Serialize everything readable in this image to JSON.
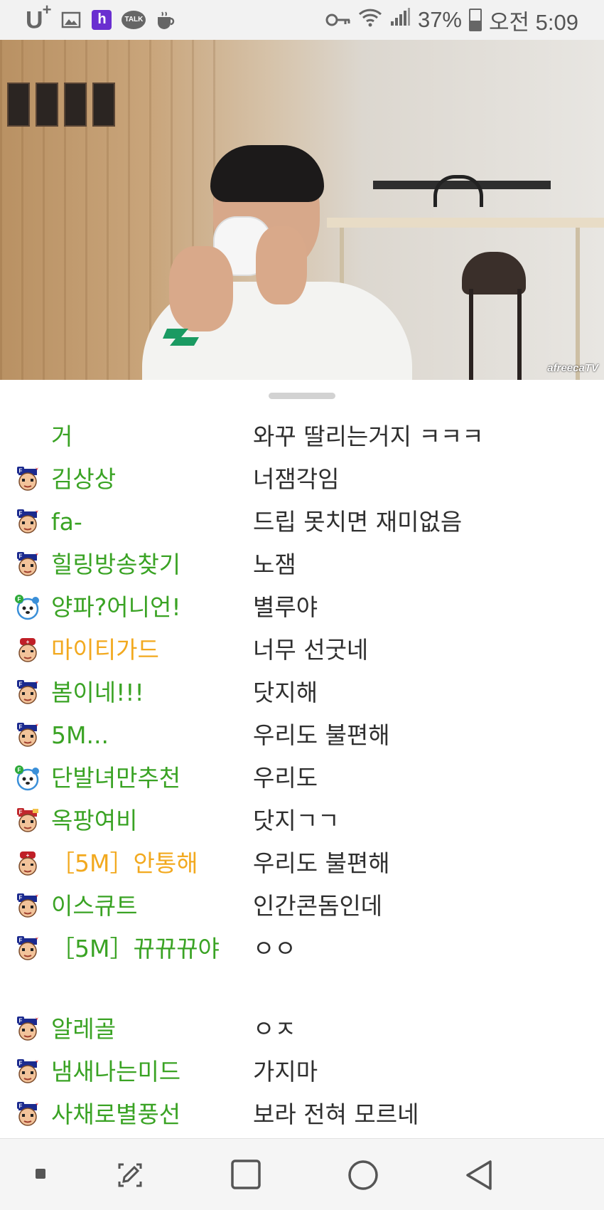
{
  "status_bar": {
    "carrier": "U",
    "carrier_plus": "+",
    "talk_label": "TALK",
    "h_label": "h",
    "battery": "37%",
    "time": "오전 5:09",
    "left_icons": [
      "gallery-icon",
      "h-app-icon",
      "kakaotalk-icon",
      "coffee-icon"
    ],
    "right_icons": [
      "key-icon",
      "wifi-icon",
      "signal-icon",
      "battery-icon"
    ]
  },
  "video": {
    "watermark": "afreecaTV"
  },
  "chat": {
    "messages": [
      {
        "nick": "거",
        "text": "와꾸 딸리는거지 ㅋㅋㅋ",
        "badge": "none",
        "color": "green"
      },
      {
        "nick": "김상상",
        "text": "너잼각임",
        "badge": "fan",
        "color": "green"
      },
      {
        "nick": "fa-",
        "text": "드립 못치면 재미없음",
        "badge": "fan",
        "color": "green"
      },
      {
        "nick": "힐링방송찾기",
        "text": "노잼",
        "badge": "fan",
        "color": "green"
      },
      {
        "nick": "양파?어니언!",
        "text": "별루야",
        "badge": "panda",
        "color": "green"
      },
      {
        "nick": "마이티가드",
        "text": "너무 선굿네",
        "badge": "guard",
        "color": "gold"
      },
      {
        "nick": "봄이네!!!",
        "text": "닷지해",
        "badge": "fan",
        "color": "green"
      },
      {
        "nick": "5M...",
        "text": "우리도 불편해",
        "badge": "fan",
        "color": "green"
      },
      {
        "nick": "단발녀만추천",
        "text": "우리도",
        "badge": "panda",
        "color": "green"
      },
      {
        "nick": "옥팡여비",
        "text": "닷지ㄱㄱ",
        "badge": "fan-red",
        "color": "green"
      },
      {
        "nick": "［5M］안통해",
        "text": "우리도 불편해",
        "badge": "guard",
        "color": "gold"
      },
      {
        "nick": "이스큐트",
        "text": "인간콘돔인데",
        "badge": "fan",
        "color": "green"
      },
      {
        "nick": "［5M］뀨뀨뀨야",
        "text": "ㅇㅇ",
        "badge": "fan",
        "color": "green"
      },
      {
        "nick": "알레골",
        "text": "ㅇㅈ",
        "badge": "fan",
        "color": "green"
      },
      {
        "nick": "냄새나는미드",
        "text": "가지마",
        "badge": "fan",
        "color": "green"
      },
      {
        "nick": "사채로별풍선",
        "text": "보라 전혀 모르네",
        "badge": "fan",
        "color": "green"
      }
    ]
  },
  "nav_bar": {
    "buttons": [
      "recent-dot",
      "screenshot-edit",
      "overview-square",
      "home-circle",
      "back-triangle"
    ]
  },
  "colors": {
    "nick_green": "#3aa324",
    "nick_gold": "#f2a91f",
    "message": "#2f2f2f"
  }
}
